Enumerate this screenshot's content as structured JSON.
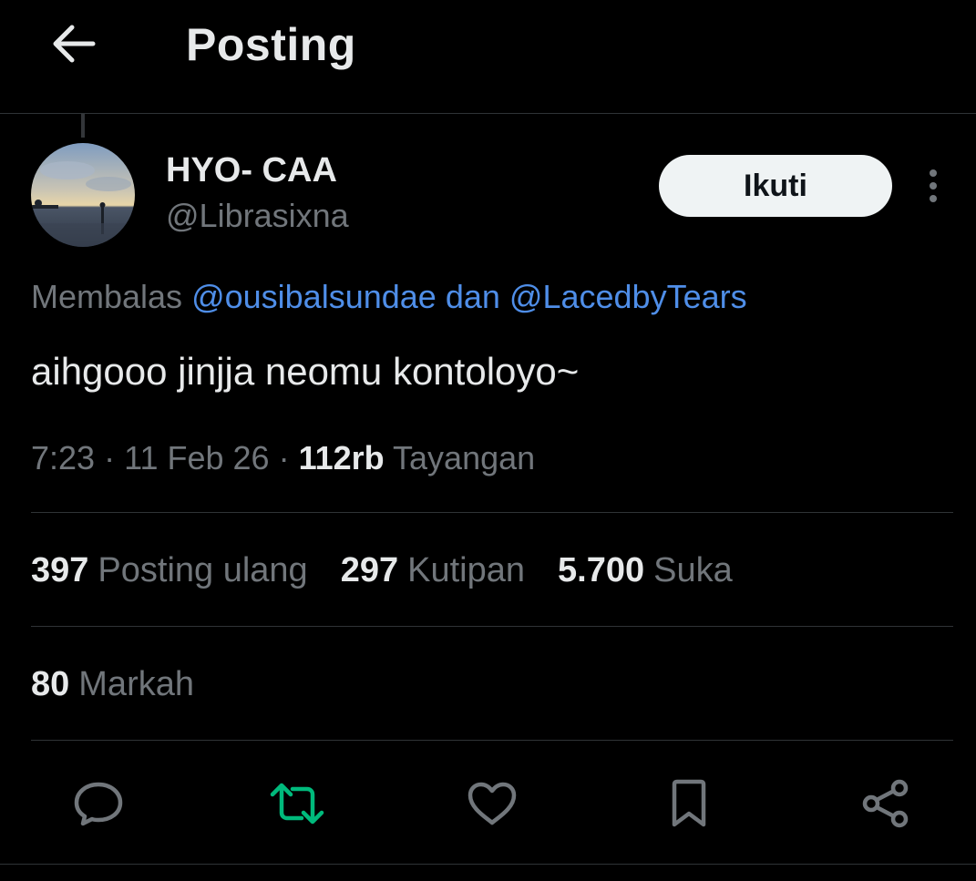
{
  "header": {
    "title": "Posting",
    "back_icon": "arrow-left-icon"
  },
  "author": {
    "display_name": "HYO- CAA",
    "handle": "@Librasixna",
    "follow_label": "Ikuti",
    "more_icon": "more-vertical-icon"
  },
  "post": {
    "reply_prefix": "Membalas",
    "reply_mention_1": "@ousibalsundae",
    "reply_conjunction": "dan",
    "reply_mention_2": "@LacedbyTears",
    "text": "aihgooo jinjja neomu kontoloyo~",
    "time": "7:23",
    "separator": "·",
    "date": "11 Feb 26",
    "views_count": "112rb",
    "views_label": "Tayangan"
  },
  "stats": {
    "reposts_count": "397",
    "reposts_label": "Posting ulang",
    "quotes_count": "297",
    "quotes_label": "Kutipan",
    "likes_count": "5.700",
    "likes_label": "Suka",
    "bookmarks_count": "80",
    "bookmarks_label": "Markah"
  },
  "actions": [
    {
      "icon": "reply-icon",
      "color": "#71767b"
    },
    {
      "icon": "repost-icon",
      "color": "#00ba7c"
    },
    {
      "icon": "like-icon",
      "color": "#71767b"
    },
    {
      "icon": "bookmark-icon",
      "color": "#71767b"
    },
    {
      "icon": "share-icon",
      "color": "#71767b"
    }
  ],
  "colors": {
    "background": "#000000",
    "text_primary": "#e7e9ea",
    "text_secondary": "#71767b",
    "link": "#4f8ee8",
    "reposted": "#00ba7c",
    "divider": "#2f3336"
  }
}
